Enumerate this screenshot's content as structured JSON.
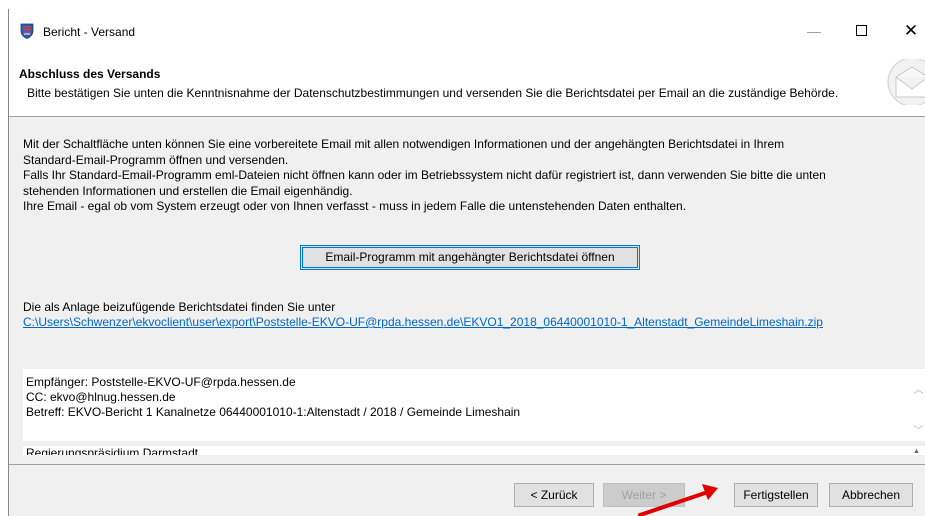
{
  "window": {
    "title": "Bericht - Versand"
  },
  "header": {
    "title": "Abschluss des Versands",
    "description": "Bitte bestätigen Sie unten die Kenntnisnahme der Datenschutzbestimmungen und versenden Sie die Berichtsdatei per Email an die zuständige Behörde."
  },
  "body": {
    "lines": [
      "Mit der Schaltfläche unten können Sie eine vorbereitete Email mit allen notwendigen Informationen und der angehängten Berichtsdatei in Ihrem",
      "Standard-Email-Programm öffnen und versenden.",
      "Falls Ihr Standard-Email-Programm eml-Dateien nicht öffnen kann oder im Betriebssystem nicht dafür registriert ist, dann verwenden Sie bitte die unten",
      "stehenden Informationen und erstellen die Email eigenhändig.",
      "Ihre Email - egal ob vom System erzeugt oder von Ihnen verfasst - muss in jedem Falle die untenstehenden Daten enthalten."
    ],
    "open_email_button": "Email-Programm mit angehängter Berichtsdatei öffnen",
    "attachment_label": "Die als Anlage beizufügende Berichtsdatei finden Sie unter",
    "attachment_path": "C:\\Users\\Schwenzer\\ekvoclient\\user\\export\\Poststelle-EKVO-UF@rpda.hessen.de\\EKVO1_2018_06440001010-1_Altenstadt_GemeindeLimeshain.zip"
  },
  "email_info": {
    "recipient": "Empfänger: Poststelle-EKVO-UF@rpda.hessen.de",
    "cc": "CC: ekvo@hlnug.hessen.de",
    "subject": "Betreff: EKVO-Bericht 1 Kanalnetze 06440001010-1:Altenstadt / 2018 / Gemeinde Limeshain"
  },
  "address_box": {
    "partial_text": "Regierungspräsidium Darmstadt"
  },
  "footer": {
    "back": "< Zurück",
    "next": "Weiter >",
    "finish": "Fertigstellen",
    "cancel": "Abbrechen"
  }
}
